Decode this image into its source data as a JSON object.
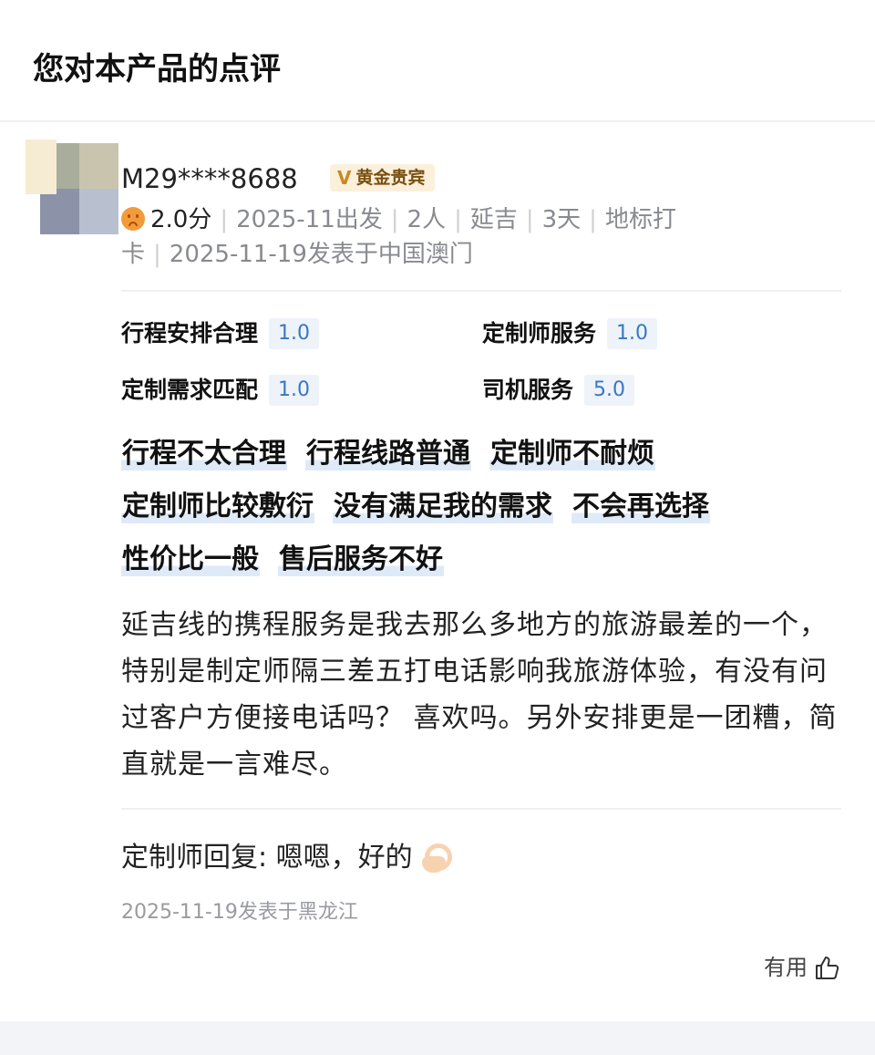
{
  "page": {
    "title": "您对本产品的点评"
  },
  "review": {
    "username": "M29****8688",
    "badge_label": "黄金贵宾",
    "badge_mark": "V",
    "face_icon": "sad-face-icon",
    "score": "2.0分",
    "travel_date": "2025-11出发",
    "people": "2人",
    "destination": "延吉",
    "duration": "3天",
    "category": "地标打卡",
    "posted": "2025-11-19发表于中国澳门",
    "ratings": [
      {
        "label": "行程安排合理",
        "value": "1.0"
      },
      {
        "label": "定制师服务",
        "value": "1.0"
      },
      {
        "label": "定制需求匹配",
        "value": "1.0"
      },
      {
        "label": "司机服务",
        "value": "5.0"
      }
    ],
    "tag_rows": [
      [
        "行程不太合理",
        "行程线路普通",
        "定制师不耐烦"
      ],
      [
        "定制师比较敷衍",
        "没有满足我的需求",
        "不会再选择"
      ],
      [
        "性价比一般",
        "售后服务不好"
      ]
    ],
    "text": "延吉线的携程服务是我去那么多地方的旅游最差的一个，特别是制定师隔三差五打电话影响我旅游体验，有没有问过客户方便接电话吗？ 喜欢吗。另外安排更是一团糟，简直就是一言难尽。"
  },
  "reply": {
    "text": "定制师回复: 嗯嗯，好的",
    "emoji_icon": "ok-hand-icon",
    "posted": "2025-11-19发表于黑龙江"
  },
  "actions": {
    "useful_label": "有用",
    "useful_icon": "thumbs-up-icon"
  },
  "colors": {
    "badge_bg": "#fbf0dc",
    "badge_text": "#7a5010",
    "rating_value_bg": "#eef3fa",
    "rating_value_text": "#3a76c4",
    "tag_highlight": "#dfeaf8",
    "meta_text": "#888a90"
  }
}
